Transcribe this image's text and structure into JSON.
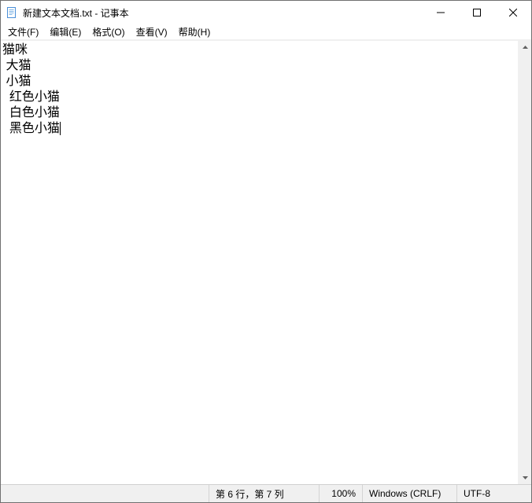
{
  "title": "新建文本文档.txt - 记事本",
  "menu": {
    "file": "文件(F)",
    "edit": "编辑(E)",
    "format": "格式(O)",
    "view": "查看(V)",
    "help": "帮助(H)"
  },
  "content": {
    "lines": [
      "猫咪",
      " 大猫",
      " 小猫",
      "  红色小猫",
      "  白色小猫",
      "  黑色小猫"
    ]
  },
  "status": {
    "position": "第 6 行，第 7 列",
    "zoom": "100%",
    "line_ending": "Windows (CRLF)",
    "encoding": "UTF-8"
  },
  "cursor": {
    "line": 5,
    "col": 6
  }
}
